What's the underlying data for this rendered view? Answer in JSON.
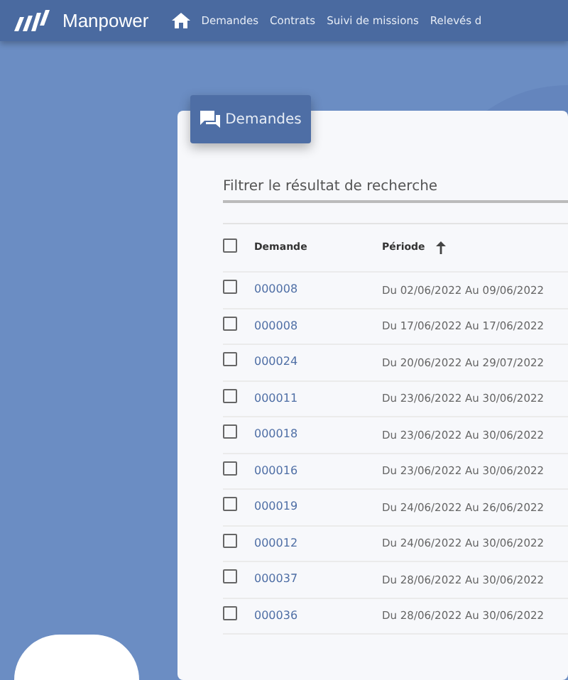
{
  "navbar": {
    "brand": "Manpower",
    "items": [
      {
        "label": "Demandes",
        "selected": false
      },
      {
        "label": "Contrats",
        "selected": false
      },
      {
        "label": "Suivi de missions",
        "selected": false
      },
      {
        "label": "Relevés d",
        "selected": false
      }
    ]
  },
  "panel": {
    "tab": "Demandes",
    "filter": {
      "placeholder": "Filtrer le résultat de recherche"
    },
    "table": {
      "select_all": {
        "checked": false
      },
      "columns": [
        {
          "label": "Demande",
          "sorted": false
        },
        {
          "label": "Période",
          "sorted": true
        }
      ],
      "rows": [
        {
          "checked": false,
          "demande": "000008",
          "periode": "Du 02/06/2022 Au 09/06/2022"
        },
        {
          "checked": false,
          "demande": "000008",
          "periode": "Du 17/06/2022 Au 17/06/2022"
        },
        {
          "checked": false,
          "demande": "000024",
          "periode": "Du 20/06/2022 Au 29/07/2022"
        },
        {
          "checked": false,
          "demande": "000011",
          "periode": "Du 23/06/2022 Au 30/06/2022"
        },
        {
          "checked": false,
          "demande": "000018",
          "periode": "Du 23/06/2022 Au 30/06/2022"
        },
        {
          "checked": false,
          "demande": "000016",
          "periode": "Du 23/06/2022 Au 30/06/2022"
        },
        {
          "checked": false,
          "demande": "000019",
          "periode": "Du 24/06/2022 Au 26/06/2022"
        },
        {
          "checked": false,
          "demande": "000012",
          "periode": "Du 24/06/2022 Au 30/06/2022"
        },
        {
          "checked": false,
          "demande": "000037",
          "periode": "Du 28/06/2022 Au 30/06/2022"
        },
        {
          "checked": false,
          "demande": "000036",
          "periode": "Du 28/06/2022 Au 30/06/2022"
        }
      ]
    }
  }
}
